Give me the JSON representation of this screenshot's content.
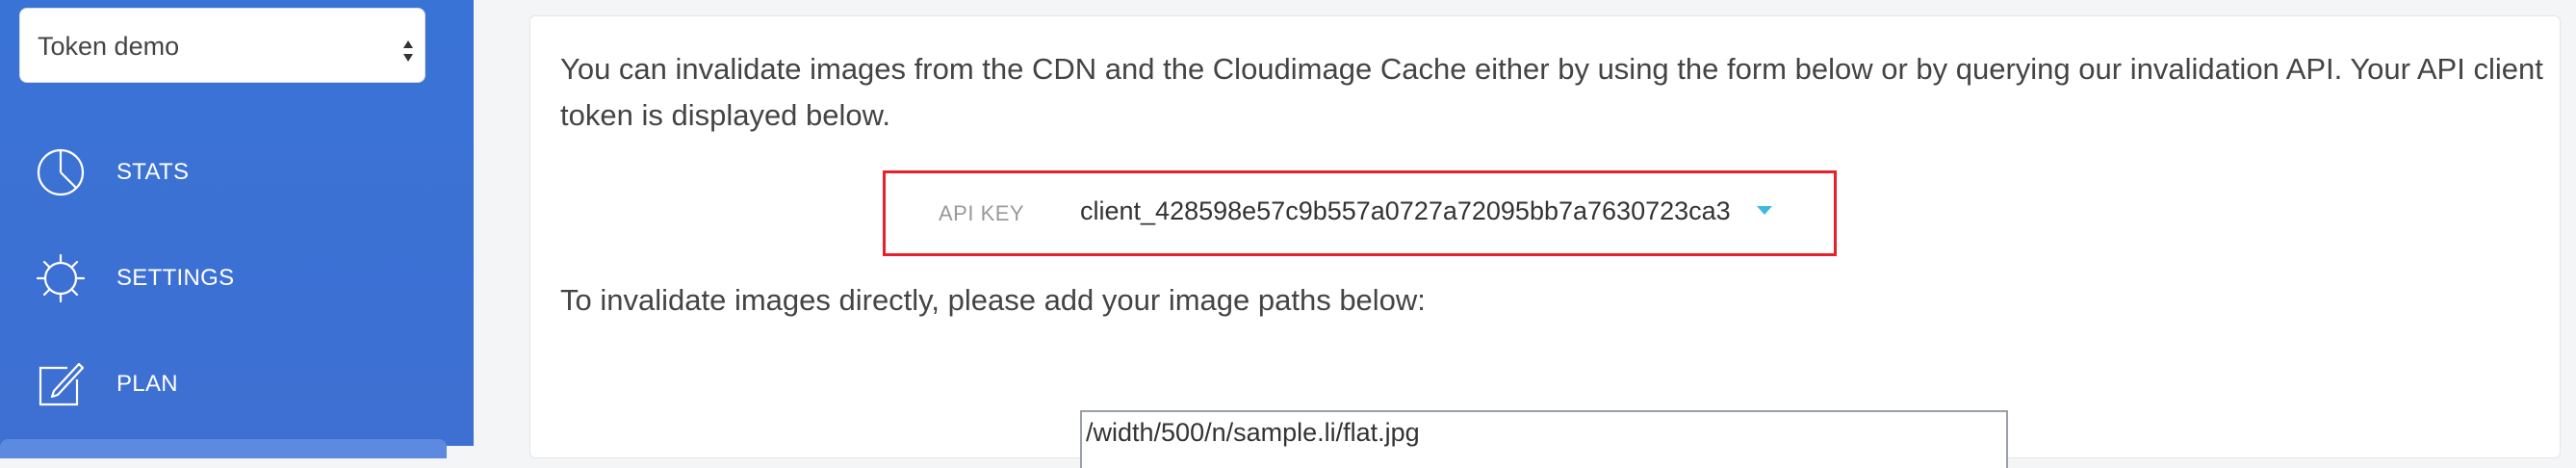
{
  "sidebar": {
    "token_select": {
      "value": "Token demo"
    },
    "items": [
      {
        "label": "STATS",
        "icon": "pie-chart-icon"
      },
      {
        "label": "SETTINGS",
        "icon": "gear-icon"
      },
      {
        "label": "PLAN",
        "icon": "edit-icon"
      }
    ]
  },
  "main": {
    "intro_text": "You can invalidate images from the CDN and the Cloudimage Cache either by using the form below or by querying our invalidation API. Your API client token is displayed below.",
    "api_key": {
      "label": "API KEY",
      "value": "client_428598e57c9b557a0727a72095bb7a7630723ca3"
    },
    "instruction_text": "To invalidate images directly, please add your image paths below:",
    "paths_input": {
      "value": "/width/500/n/sample.li/flat.jpg"
    }
  },
  "colors": {
    "sidebar_bg": "#3a73d6",
    "highlight_border": "#e8202a",
    "caret": "#3fb8e0"
  }
}
